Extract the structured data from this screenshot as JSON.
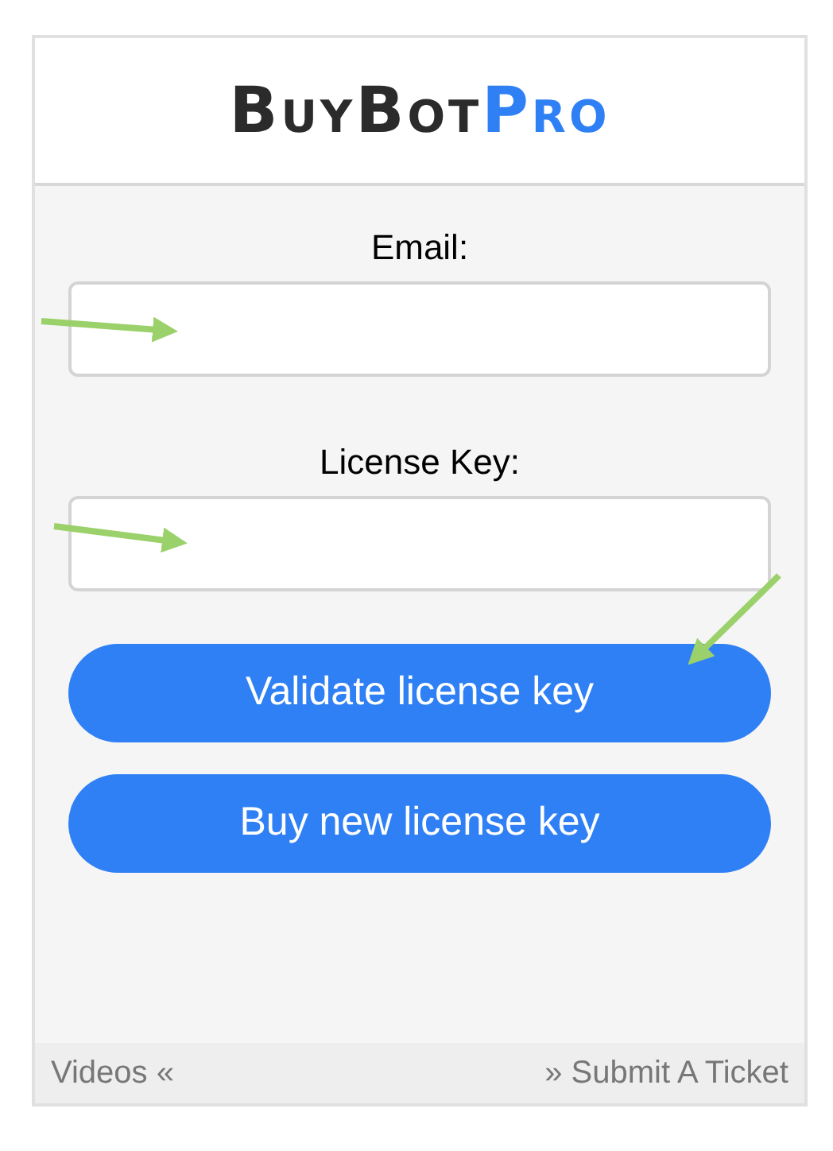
{
  "logo": {
    "main": "BuyBot",
    "accent": "Pro"
  },
  "fields": [
    {
      "label": "Email:"
    },
    {
      "label": "License Key:"
    }
  ],
  "buttons": [
    "Validate license key",
    "Buy new license key"
  ],
  "footer": {
    "left_link": "Videos «",
    "right_link": "» Submit A Ticket"
  }
}
